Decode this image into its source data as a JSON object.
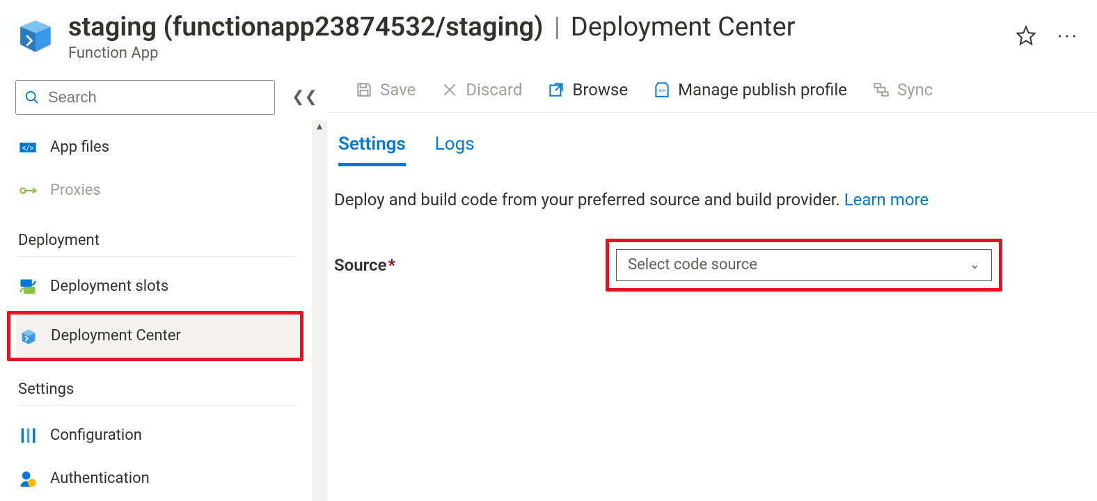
{
  "header": {
    "title_main": "staging (functionapp23874532/staging)",
    "title_section": "Deployment Center",
    "subtitle": "Function App"
  },
  "sidebar": {
    "search_placeholder": "Search",
    "items": {
      "app_files": "App files",
      "proxies": "Proxies",
      "deployment_slots": "Deployment slots",
      "deployment_center": "Deployment Center",
      "configuration": "Configuration",
      "authentication": "Authentication"
    },
    "sections": {
      "deployment": "Deployment",
      "settings": "Settings"
    }
  },
  "toolbar": {
    "save": "Save",
    "discard": "Discard",
    "browse": "Browse",
    "manage_publish_profile": "Manage publish profile",
    "sync": "Sync"
  },
  "tabs": {
    "settings": "Settings",
    "logs": "Logs"
  },
  "content": {
    "description": "Deploy and build code from your preferred source and build provider. ",
    "learn_more": "Learn more",
    "source_label": "Source",
    "source_placeholder": "Select code source"
  }
}
